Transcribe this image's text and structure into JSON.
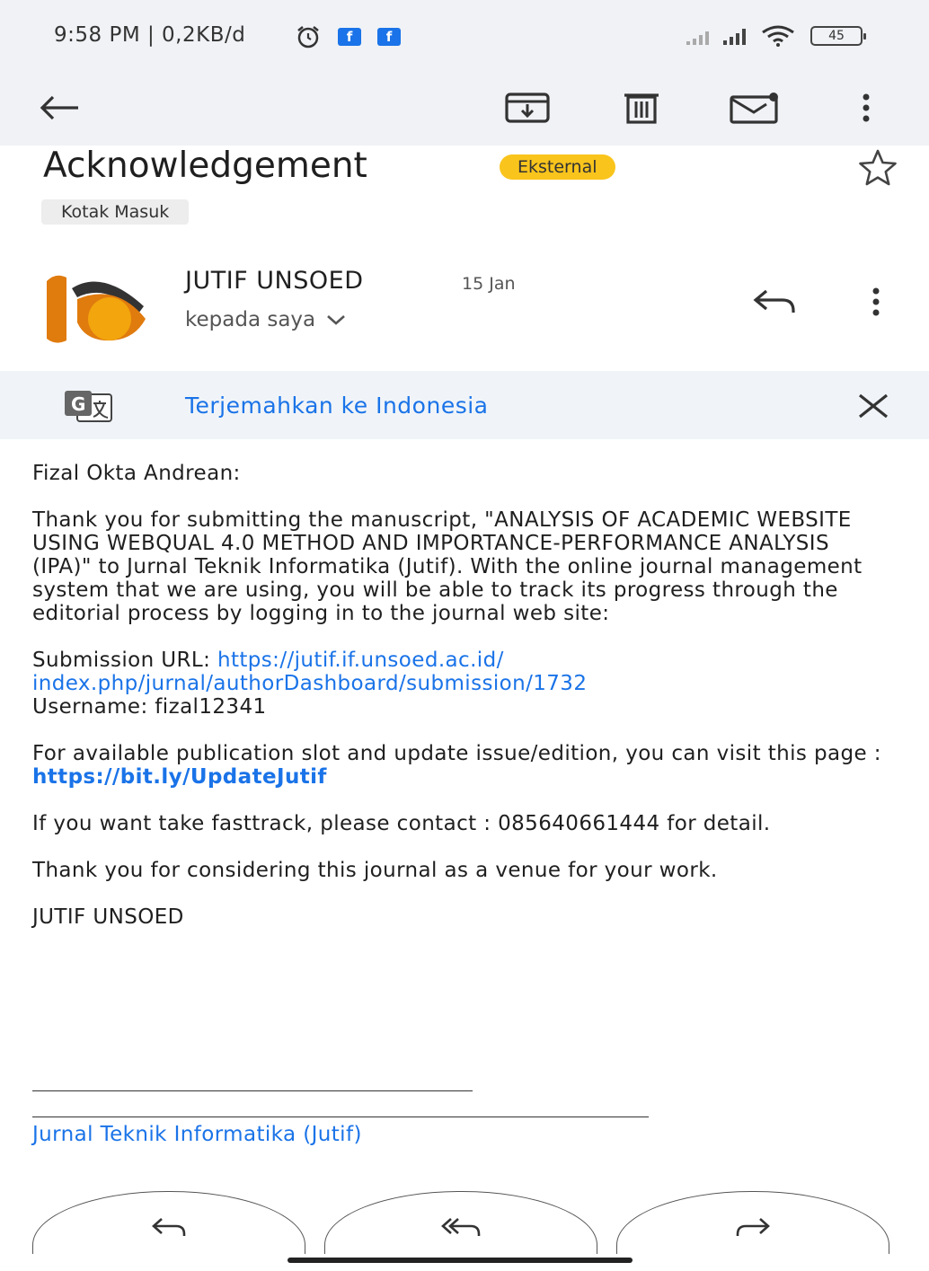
{
  "status_bar": {
    "time": "9:58 PM | 0,2KB/d",
    "battery": "45"
  },
  "email": {
    "subject": "Acknowledgement",
    "label": "Eksternal",
    "folder": "Kotak Masuk",
    "sender": "JUTIF UNSOED",
    "date": "15 Jan",
    "recipient": "kepada saya"
  },
  "translate": {
    "link": "Terjemahkan ke Indonesia"
  },
  "body": {
    "greeting": "Fizal Okta Andrean:",
    "paragraph1": "Thank you for submitting the manuscript, \"ANALYSIS OF ACADEMIC WEBSITE USING WEBQUAL 4.0 METHOD AND IMPORTANCE-PERFORMANCE ANALYSIS (IPA)\" to Jurnal Teknik Informatika (Jutif). With the online journal management system that we are using, you will be able to track its progress through the editorial process by logging in to the journal web site:",
    "submission_label": "Submission URL: ",
    "submission_url": "https://jutif.if.unsoed.ac.id/ index.php/jurnal/authorDashboard/submission/1732",
    "username": "Username: fizal12341",
    "slot_text": "For available publication slot and update issue/edition, you can visit this page : ",
    "slot_url": "https://bit.ly/UpdateJutif",
    "fasttrack": "If you want take fasttrack, please contact : 085640661444 for detail.",
    "thanks": "Thank you for considering this journal as a venue for your work.",
    "signoff": "JUTIF UNSOED",
    "journal_link": "Jurnal Teknik Informatika (Jutif)"
  },
  "colors": {
    "link": "#1a73e8",
    "label_chip": "#f9c41c",
    "toolbar_bg": "#f0f2f6"
  }
}
